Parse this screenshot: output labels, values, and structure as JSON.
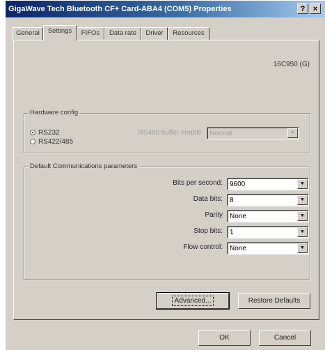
{
  "window": {
    "title": "GigaWave Tech Bluetooth CF+ Card-ABA4 (COM5) Properties",
    "help_label": "?",
    "close_label": "×"
  },
  "tabs": [
    {
      "label": "General",
      "active": false
    },
    {
      "label": "Settings",
      "active": true
    },
    {
      "label": "FIFOs",
      "active": false
    },
    {
      "label": "Data rate",
      "active": false
    },
    {
      "label": "Driver",
      "active": false
    },
    {
      "label": "Resources",
      "active": false
    }
  ],
  "chip_id": "16C950 (G)",
  "hardware_config": {
    "legend": "Hardware config",
    "radio_rs232": {
      "label": "RS232",
      "checked": true
    },
    "radio_rs422": {
      "label": "RS422/485",
      "checked": false
    },
    "rs485_label": "RS485 buffer enable",
    "rs485_value": "Normal"
  },
  "comm_params": {
    "legend": "Default Communications parameters",
    "bits_per_second": {
      "label": "Bits per second:",
      "value": "9600"
    },
    "data_bits": {
      "label": "Data bits:",
      "value": "8"
    },
    "parity": {
      "label": "Parity",
      "value": "None"
    },
    "stop_bits": {
      "label": "Stop bits:",
      "value": "1"
    },
    "flow_control": {
      "label": "Flow control:",
      "value": "None"
    }
  },
  "buttons": {
    "advanced": "Advanced...",
    "restore_defaults": "Restore Defaults",
    "ok": "OK",
    "cancel": "Cancel"
  },
  "colors": {
    "titlebar_start": "#0a246a",
    "titlebar_end": "#a6caf0",
    "face": "#d4d0c8"
  }
}
